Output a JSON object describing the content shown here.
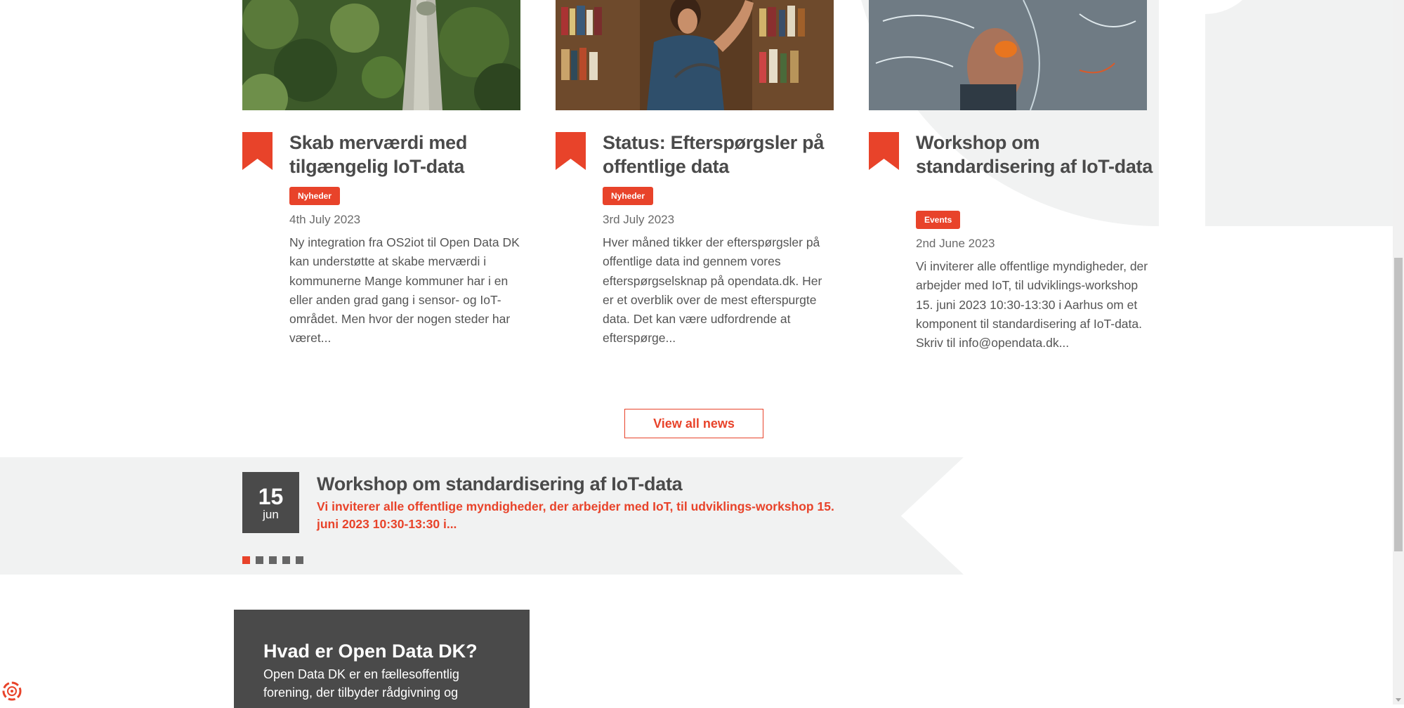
{
  "news": [
    {
      "title": "Skab merværdi med tilgængelig IoT-data",
      "tag": "Nyheder",
      "date": "4th July 2023",
      "excerpt": "Ny integration fra OS2iot til Open Data DK kan understøtte at skabe merværdi i kommunerne Mange kommuner har i en eller anden grad gang i sensor- og IoT-området. Men hvor der nogen steder har været..."
    },
    {
      "title": "Status: Efterspørgsler på offentlige data",
      "tag": "Nyheder",
      "date": "3rd July 2023",
      "excerpt": "Hver måned tikker der efterspørgsler på offentlige data ind gennem vores efterspørgselsknap på opendata.dk. Her er et overblik over de mest efterspurgte data. Det kan være udfordrende at efterspørge..."
    },
    {
      "title": "Workshop om standardisering af IoT-data",
      "tag": "Events",
      "date": "2nd June 2023",
      "excerpt": "Vi inviterer alle offentlige myndigheder, der arbejder med IoT, til udviklings-workshop 15. juni 2023 10:30-13:30 i Aarhus om et komponent til standardisering af IoT-data. Skriv til info@opendata.dk..."
    }
  ],
  "view_all_label": "View all news",
  "event": {
    "day": "15",
    "month": "jun",
    "title": "Workshop om standardisering af IoT-data",
    "description": "Vi inviterer alle offentlige myndigheder, der arbejder med IoT, til udviklings-workshop 15. juni 2023 10:30-13:30 i..."
  },
  "about": {
    "title": "Hvad er Open Data DK?",
    "text": "Open Data DK er en fællesoffentlig forening, der tilbyder rådgivning og"
  },
  "colors": {
    "accent": "#e8432a",
    "dark": "#4a4a4a",
    "light_bg": "#f1f2f2"
  }
}
